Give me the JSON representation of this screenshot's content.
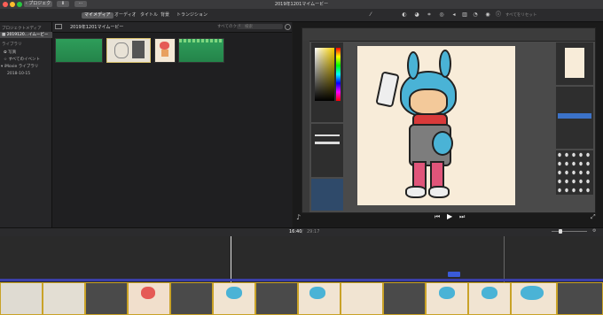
{
  "window": {
    "title": "2019年1201マイムービー"
  },
  "toolbar": {
    "back_label": "プロジェクト"
  },
  "media_tabs": [
    {
      "label": "マイメディア",
      "active": true
    },
    {
      "label": "オーディオ",
      "active": false
    },
    {
      "label": "タイトル",
      "active": false
    },
    {
      "label": "背景",
      "active": false
    },
    {
      "label": "トランジション",
      "active": false
    }
  ],
  "sidebar": {
    "section_project": "プロジェクトメディア",
    "project_item": "2019120...イムービー",
    "section_library": "ライブラリ",
    "items": [
      "写真",
      "すべてのイベント",
      "iMovie ライブラリ",
      "2018-10-15"
    ]
  },
  "browser": {
    "title": "2019年1201マイムービー",
    "filter_label": "すべてのクリップ",
    "search_placeholder": "検索"
  },
  "viewer": {
    "reset_label": "すべてをリセット"
  },
  "timeline": {
    "current_time": "16:40",
    "total_time": "29:17"
  },
  "colors": {
    "accent": "#2f6df6",
    "clip_border": "#c9a227",
    "green_clip": "#2e9e5a"
  }
}
